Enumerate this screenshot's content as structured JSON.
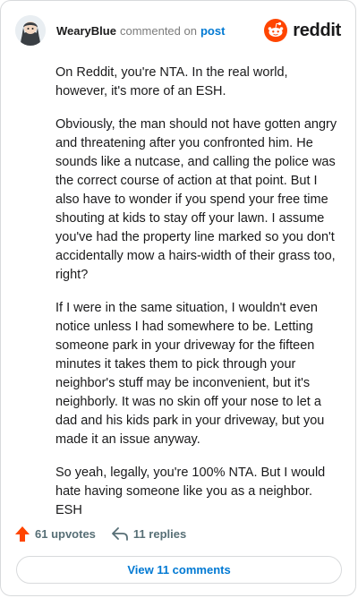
{
  "header": {
    "username": "WearyBlue",
    "commented_on": "commented on",
    "post_link": "post",
    "brand": "reddit"
  },
  "comment": {
    "paragraphs": [
      "On Reddit, you're NTA. In the real world, however, it's more of an ESH.",
      "Obviously, the man should not have gotten angry and threatening after you confronted him. He sounds like a nutcase, and calling the police was the correct course of action at that point. But I also have to wonder if you spend your free time shouting at kids to stay off your lawn. I assume you've had the property line marked so you don't accidentally mow a hairs-width of their grass too, right?",
      "If I were in the same situation, I wouldn't even notice unless I had somewhere to be. Letting someone park in your driveway for the fifteen minutes it takes them to pick through your neighbor's stuff may be inconvenient, but it's neighborly. It was no skin off your nose to let a dad and his kids park in your driveway, but you made it an issue anyway.",
      "So yeah, legally, you're 100% NTA. But I would hate having someone like you as a neighbor. ESH"
    ]
  },
  "actions": {
    "upvotes": "61 upvotes",
    "replies": "11 replies"
  },
  "view_comments": "View 11 comments",
  "colors": {
    "brand_orange": "#ff4500",
    "link_blue": "#0079d3",
    "upvote_orange": "#ff4500"
  },
  "icons": {
    "brand": "reddit-snoo-icon",
    "upvote": "upvote-arrow-icon",
    "reply": "reply-arrow-icon"
  }
}
